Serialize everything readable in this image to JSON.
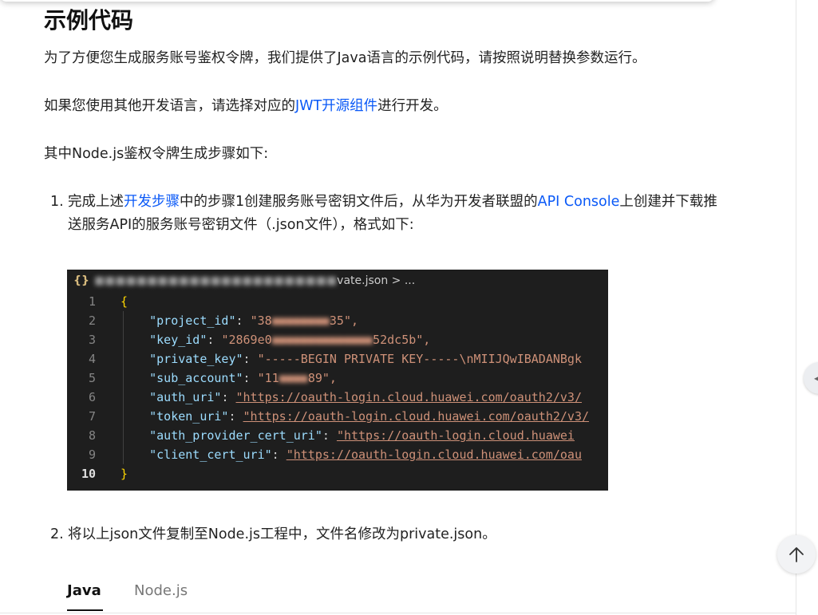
{
  "section": {
    "title": "示例代码",
    "intro": "为了方便您生成服务账号鉴权令牌，我们提供了Java语言的示例代码，请按照说明替换参数运行。",
    "other_lang_prefix": "如果您使用其他开发语言，请选择对应的",
    "other_lang_link": "JWT开源组件",
    "other_lang_suffix": "进行开发。",
    "steps_intro": "其中Node.js鉴权令牌生成步骤如下:"
  },
  "steps": [
    {
      "num": "1.",
      "t1": "完成上述",
      "link1": "开发步骤",
      "t2": "中的步骤1创建服务账号密钥文件后，从华为开发者联盟的",
      "link2": "API Console",
      "t3": "上创建并下载推送服务API的服务账号密钥文件（.json文件），格式如下:"
    },
    {
      "num": "2.",
      "text": "将以上json文件复制至Node.js工程中，文件名修改为private.json。"
    }
  ],
  "code_image": {
    "breadcrumb_suffix": "vate.json > ...",
    "line_numbers": [
      "1",
      "2",
      "3",
      "4",
      "5",
      "6",
      "7",
      "8",
      "9",
      "10"
    ],
    "open_brace": "{",
    "close_brace": "}",
    "lines": [
      {
        "key": "\"project_id\"",
        "value": "\"38",
        "value_end": "35\","
      },
      {
        "key": "\"key_id\"",
        "value": "\"2869e0",
        "value_end": "52dc5b\","
      },
      {
        "key": "\"private_key\"",
        "value": "\"-----BEGIN PRIVATE KEY-----\\nMIIJQwIBADANBgk"
      },
      {
        "key": "\"sub_account\"",
        "value": "\"11",
        "value_end": "89\","
      },
      {
        "key": "\"auth_uri\"",
        "value": "\"https://oauth-login.cloud.huawei.com/oauth2/v3/"
      },
      {
        "key": "\"token_uri\"",
        "value": "\"https://oauth-login.cloud.huawei.com/oauth2/v3/"
      },
      {
        "key": "\"auth_provider_cert_uri\"",
        "value": "\"https://oauth-login.cloud.huawei"
      },
      {
        "key": "\"client_cert_uri\"",
        "value": "\"https://oauth-login.cloud.huawei.com/oau"
      }
    ]
  },
  "tabs": [
    {
      "label": "Java",
      "active": true
    },
    {
      "label": "Node.js",
      "active": false
    }
  ],
  "colors": {
    "link": "#0a59f7",
    "code_bg": "#1e1e1e"
  },
  "icons": {
    "back_to_top": "arrow-up-icon",
    "side_panel": "chevron-left-icon"
  }
}
